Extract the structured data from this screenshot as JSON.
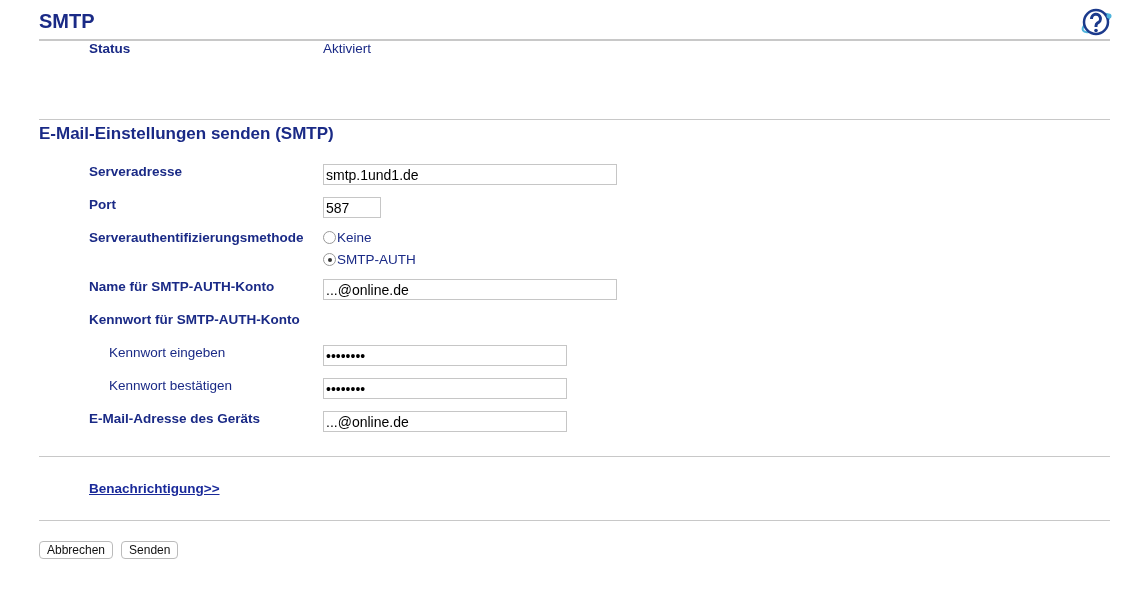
{
  "page": {
    "title": "SMTP"
  },
  "status": {
    "label": "Status",
    "value": "Aktiviert"
  },
  "section": {
    "title": "E-Mail-Einstellungen senden (SMTP)"
  },
  "rows": [
    {
      "kind": "wide",
      "label": "Serveradresse",
      "value": "smtp.1und1.de"
    },
    {
      "kind": "short",
      "label": "Port",
      "value": "587"
    },
    {
      "kind": "radio",
      "label": "Serverauthentifizierungsmethode",
      "options": [
        {
          "label": "Keine",
          "selected": false
        },
        {
          "label": "SMTP-AUTH",
          "selected": true
        }
      ]
    },
    {
      "kind": "wide",
      "label": "Name für SMTP-AUTH-Konto",
      "value": "...@online.de"
    },
    {
      "kind": "group",
      "label": "Kennwort für SMTP-AUTH-Konto",
      "children": [
        {
          "kind": "medium",
          "label": "Kennwort eingeben",
          "value": "••••••••"
        },
        {
          "kind": "medium",
          "label": "Kennwort bestätigen",
          "value": "••••••••"
        }
      ]
    },
    {
      "kind": "medium",
      "label": "E-Mail-Adresse des Geräts",
      "value": "...@online.de"
    }
  ],
  "link": "Benachrichtigung>>",
  "buttons": [
    "Abbrechen",
    "Senden"
  ]
}
